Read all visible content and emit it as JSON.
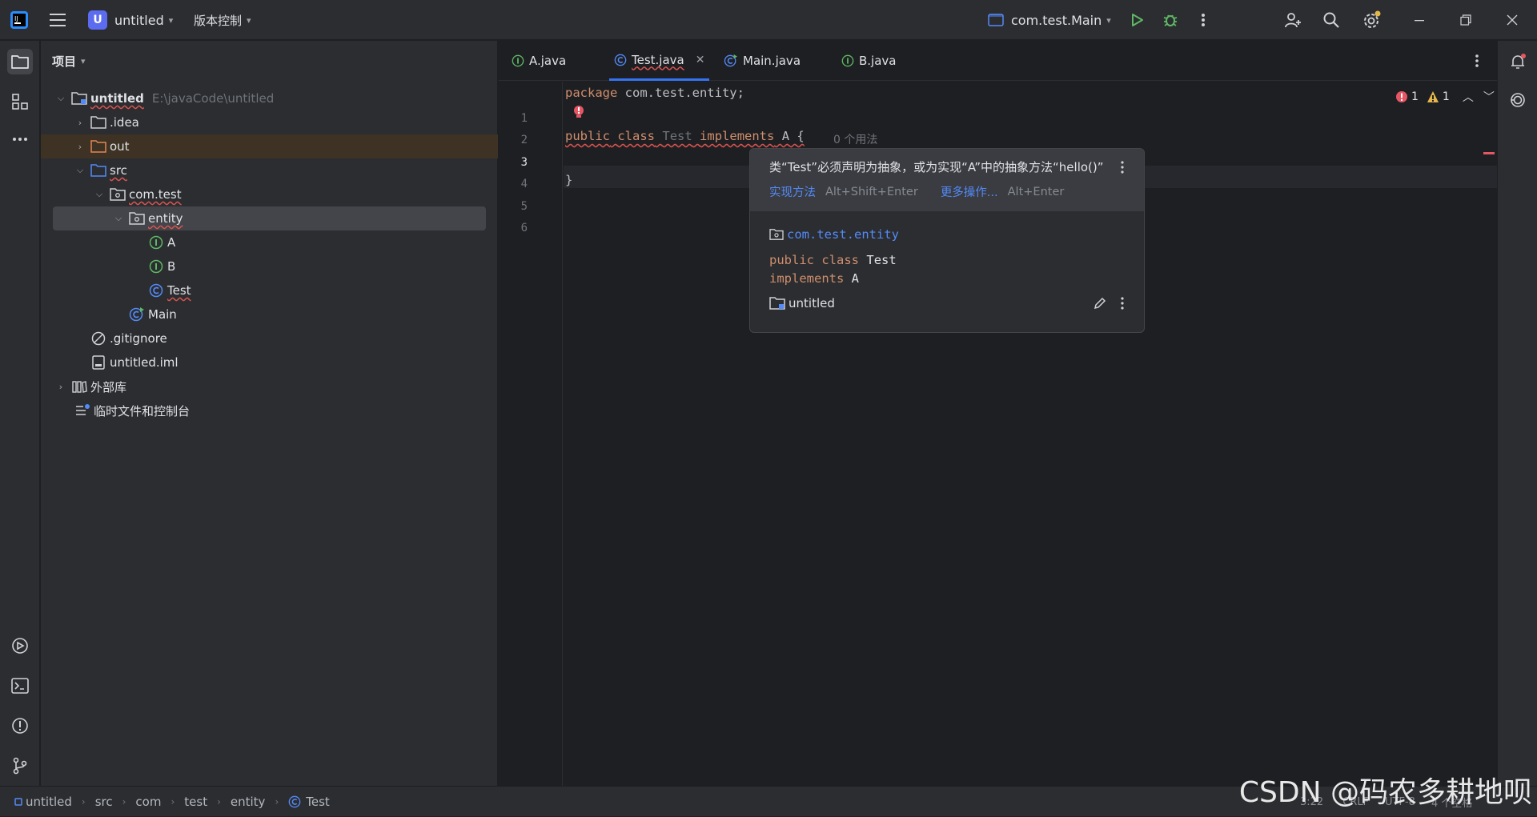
{
  "titlebar": {
    "project_badge": "U",
    "project_name": "untitled",
    "vcs_label": "版本控制",
    "run_config": "com.test.Main"
  },
  "project_panel": {
    "title": "项目",
    "root_name": "untitled",
    "root_path": "E:\\javaCode\\untitled",
    "items": {
      "idea": ".idea",
      "out": "out",
      "src": "src",
      "com_test": "com.test",
      "entity": "entity",
      "a": "A",
      "b": "B",
      "test": "Test",
      "main": "Main",
      "gitignore": ".gitignore",
      "iml": "untitled.iml",
      "external_libs": "外部库",
      "scratches": "临时文件和控制台"
    }
  },
  "tabs": [
    {
      "label": "A.java"
    },
    {
      "label": "Test.java"
    },
    {
      "label": "Main.java"
    },
    {
      "label": "B.java"
    }
  ],
  "editor": {
    "line_numbers": [
      "1",
      "2",
      "3",
      "4",
      "5",
      "6"
    ],
    "line1_kw": "package",
    "line1_rest": " com.test.entity;",
    "line3_public": "public",
    "line3_class": "class",
    "line3_name": "Test",
    "line3_impl": "implements",
    "line3_iface": "A",
    "line3_brace": "{",
    "line3_usages": "0 个用法",
    "line5": "}",
    "error_count": "1",
    "warning_count": "1"
  },
  "popup": {
    "message": "类“Test”必须声明为抽象，或为实现“A”中的抽象方法“hello()”",
    "action_implement": "实现方法",
    "action_implement_keys": "Alt+Shift+Enter",
    "action_more": "更多操作...",
    "action_more_keys": "Alt+Enter",
    "package": "com.test.entity",
    "decl_kw1": "public",
    "decl_kw2": "class",
    "decl_name": "Test",
    "decl_kw3": "implements",
    "decl_iface": "A",
    "module": "untitled"
  },
  "statusbar": {
    "crumbs": [
      "untitled",
      "src",
      "com",
      "test",
      "entity",
      "Test"
    ],
    "position": "3:22",
    "line_sep": "CRLF",
    "encoding": "UTF-8",
    "indent": "4 个空格"
  },
  "watermark": "CSDN @码农多耕地呗",
  "colors": {
    "accent": "#3574f0",
    "error": "#e55765",
    "keyword": "#cf8e6d",
    "link": "#548af7"
  }
}
